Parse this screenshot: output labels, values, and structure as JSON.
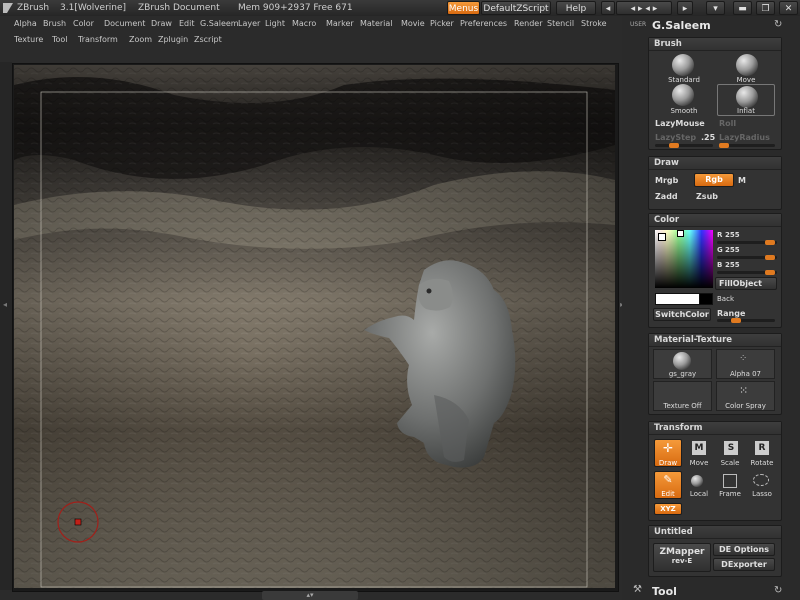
{
  "titlebar": {
    "app": "ZBrush",
    "version": "3.1[Wolverine]",
    "document": "ZBrush Document",
    "mem": "Mem 909+2937 Free 671",
    "menus_btn": "Menus",
    "script_btn": "DefaultZScript",
    "help_btn": "Help"
  },
  "menu_row1": [
    "Alpha",
    "Brush",
    "Color",
    "Document",
    "Draw",
    "Edit",
    "G.Saleem",
    "Layer",
    "Light",
    "Macro",
    "Marker",
    "Material",
    "Movie",
    "Picker",
    "Preferences",
    "Render",
    "Stencil",
    "Stroke"
  ],
  "menu_row2": [
    "Texture",
    "Tool",
    "Transform",
    "Zoom",
    "Zplugin",
    "Zscript"
  ],
  "right": {
    "user_label": "USER",
    "user_name": "G.Saleem",
    "brush": {
      "title": "Brush",
      "items": [
        "Standard",
        "Move",
        "Smooth",
        "Inflat"
      ],
      "lazymouse": "LazyMouse",
      "roll": "Roll",
      "lazystep": "LazyStep",
      "lazystep_value": ".25",
      "lazyradius": "LazyRadius"
    },
    "draw": {
      "title": "Draw",
      "mrgb": "Mrgb",
      "rgb": "Rgb",
      "m": "M",
      "zadd": "Zadd",
      "zsub": "Zsub"
    },
    "color": {
      "title": "Color",
      "r_label": "R",
      "r_value": "255",
      "g_label": "G",
      "g_value": "255",
      "b_label": "B",
      "b_value": "255",
      "fillobject": "FillObject",
      "back": "Back",
      "switchcolor": "SwitchColor",
      "range": "Range"
    },
    "matex": {
      "title": "Material-Texture",
      "items": [
        "gs_gray",
        "Alpha 07",
        "Texture Off",
        "Color Spray"
      ]
    },
    "transform": {
      "title": "Transform",
      "row1": [
        "Draw",
        "Move",
        "Scale",
        "Rotate"
      ],
      "row2": [
        "Edit",
        "Local",
        "Frame",
        "Lasso"
      ],
      "xyz": "XYZ",
      "letters": [
        "M",
        "S",
        "R"
      ]
    },
    "untitled": {
      "title": "Untitled",
      "zmapper": "ZMapper",
      "zmapper_rev": "rev-E",
      "de_options": "DE Options",
      "dexporter": "DExporter"
    },
    "tool_label": "Tool"
  },
  "colors": {
    "accent": "#e8801e",
    "panel": "#333333",
    "background": "#2b2b2b"
  }
}
